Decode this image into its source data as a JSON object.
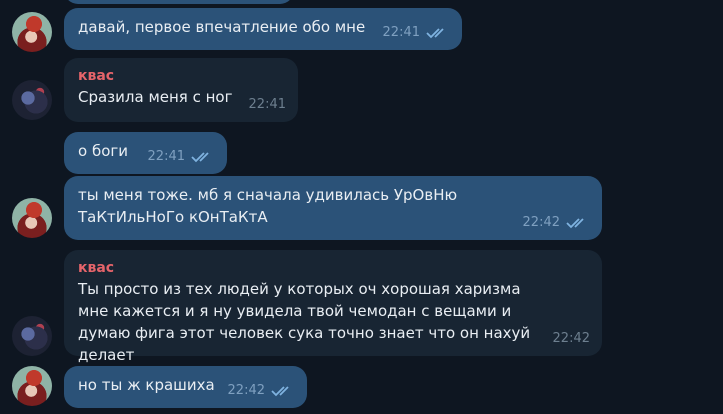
{
  "messages": [
    {
      "direction": "out",
      "avatar": "red-hair-avatar",
      "sender": "",
      "text": "давай, первое впечатление обо мне",
      "time": "22:41",
      "read": true
    },
    {
      "direction": "in",
      "avatar": "dark-hair-avatar",
      "sender": "квас",
      "text": "Сразила меня с ног",
      "time": "22:41",
      "read": false
    },
    {
      "direction": "out",
      "avatar": "",
      "sender": "",
      "text": "о боги",
      "time": "22:41",
      "read": true
    },
    {
      "direction": "out",
      "avatar": "red-hair-avatar",
      "sender": "",
      "text": "ты меня тоже. мб я сначала удивилась УрОвНю ТаКтИльНоГо кОнТаКтА",
      "time": "22:42",
      "read": true
    },
    {
      "direction": "in",
      "avatar": "dark-hair-avatar",
      "sender": "квас",
      "text": "Ты просто из тех людей у которых оч хорошая харизма мне кажется и я ну увидела твой чемодан с вещами и думаю фига этот человек сука точно знает что он нахуй делает",
      "time": "22:42",
      "read": false
    },
    {
      "direction": "out",
      "avatar": "red-hair-avatar",
      "sender": "",
      "text": "но ты ж крашиха",
      "time": "22:42",
      "read": true
    }
  ],
  "colors": {
    "background": "#0e1621",
    "outgoing": "#2b5278",
    "incoming": "#182533",
    "sender": "#e5646a"
  },
  "icons": {
    "read": "double-check-icon"
  }
}
